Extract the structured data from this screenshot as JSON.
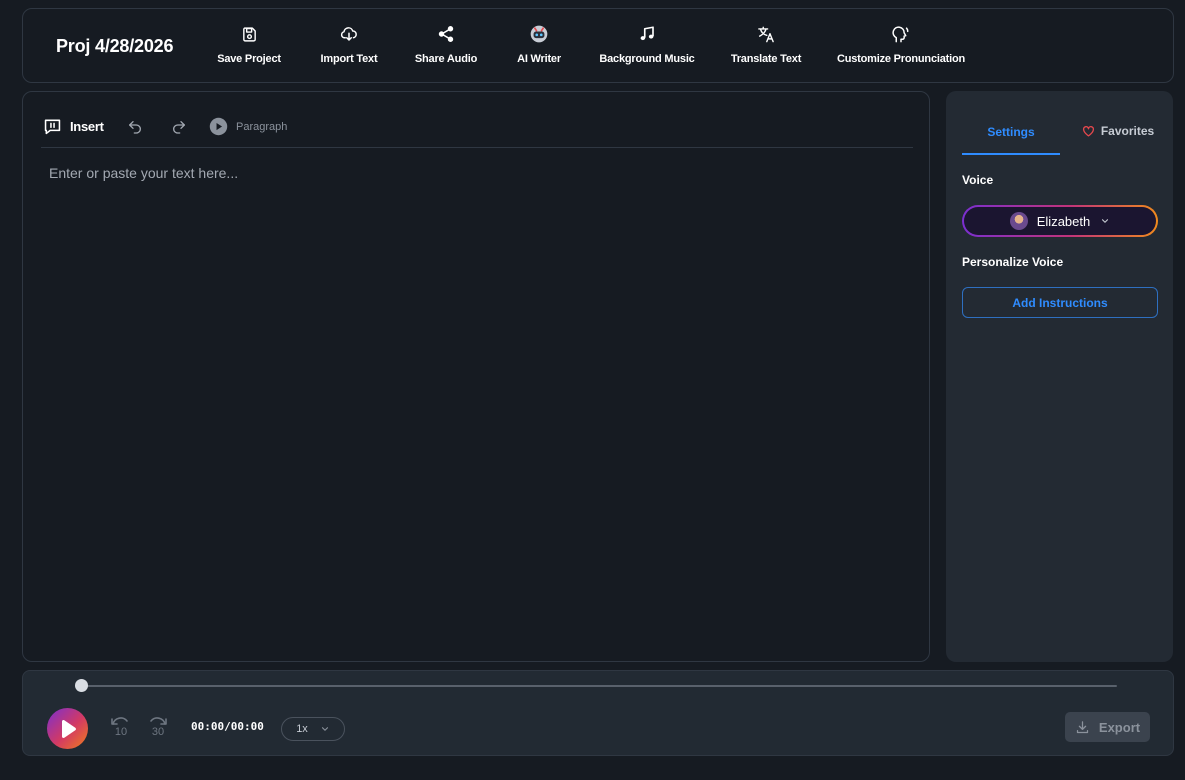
{
  "project": {
    "title": "Proj 4/28/2026"
  },
  "toolbar": {
    "save_project": "Save Project",
    "import_text": "Import Text",
    "share_audio": "Share Audio",
    "ai_writer": "AI Writer",
    "background_music": "Background Music",
    "translate_text": "Translate Text",
    "customize_pronunciation": "Customize Pronunciation"
  },
  "editor": {
    "insert_label": "Insert",
    "paragraph_label": "Paragraph",
    "placeholder": "Enter or paste your text here...",
    "value": ""
  },
  "sidepanel": {
    "tabs": [
      {
        "label": "Settings",
        "active": true
      },
      {
        "label": "Favorites",
        "active": false
      }
    ],
    "voice_label": "Voice",
    "selected_voice": "Elizabeth",
    "personalize_label": "Personalize Voice",
    "add_instructions": "Add Instructions"
  },
  "player": {
    "time": "00:00/00:00",
    "progress": 0,
    "skip_back": "10",
    "skip_forward": "30",
    "speed": "1x",
    "export_label": "Export"
  },
  "colors": {
    "accent": "#2f8cff",
    "background": "#161b22",
    "panel": "#232a33",
    "gradient_start": "#7b2fd0",
    "gradient_end": "#f08a1d",
    "heart": "#e5484d"
  }
}
